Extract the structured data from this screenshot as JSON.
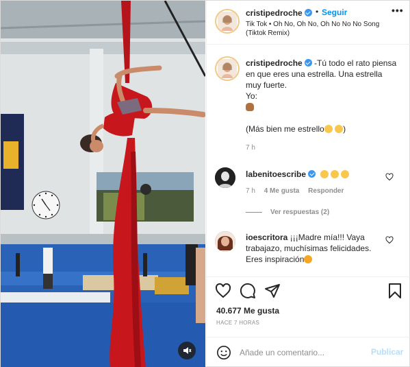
{
  "header": {
    "username": "cristipedroche",
    "separator": "•",
    "follow_label": "Seguir",
    "more_icon": "•••",
    "song": "Tik Tok • Oh No, Oh No, Oh No No No Song (Tiktok Remix)"
  },
  "caption": {
    "username": "cristipedroche",
    "text": "-Tú todo el rato piensa en que eres una estrella. Una estrella muy fuerte.",
    "yo": "Yo:",
    "aside": "(Más bien me estrello",
    "aside_end": ")",
    "time": "7 h"
  },
  "comments": [
    {
      "username": "labenitoescribe",
      "time": "7 h",
      "likes": "4 Me gusta",
      "reply": "Responder",
      "view_replies": "Ver respuestas (2)"
    },
    {
      "username": "ioescritora",
      "text": "¡¡¡Madre mía!!! Vaya trabajazo, muchísimas felicidades. Eres inspiración"
    }
  ],
  "actions": {
    "likes": "40.677 Me gusta",
    "ago": "HACE 7 HORAS"
  },
  "add_comment": {
    "placeholder": "Añade un comentario...",
    "publish": "Publicar"
  },
  "colors": {
    "accent": "#0095f6",
    "publish_disabled": "#b2dffc",
    "silk": "#c8161d"
  },
  "icons": [
    "verified-icon",
    "heart-icon",
    "comment-icon",
    "share-icon",
    "bookmark-icon",
    "smiley-icon",
    "mute-icon",
    "more-icon"
  ]
}
